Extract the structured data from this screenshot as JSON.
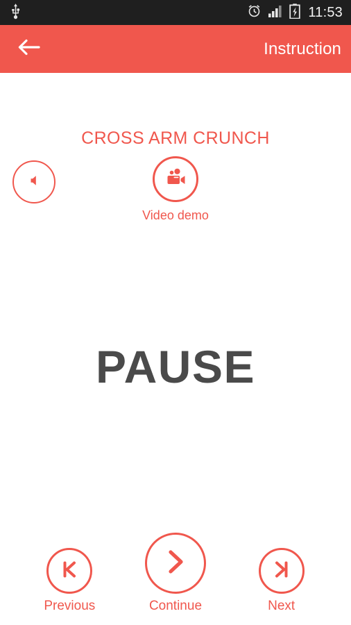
{
  "status_bar": {
    "left_icons": [
      {
        "name": "usb-icon",
        "label": "USB connected"
      }
    ],
    "right_icons": [
      {
        "name": "alarm-clock-icon",
        "label": "Alarm set"
      },
      {
        "name": "signal-bars-icon",
        "label": "Signal strength"
      },
      {
        "name": "battery-charging-icon",
        "label": "Battery charging"
      }
    ],
    "time": "11:53",
    "background_color": "#1f1f1f",
    "text_color": "#f2f2f2"
  },
  "app_bar": {
    "back_icon": "arrow-left-icon",
    "title": "Instruction",
    "background_color": "#f0574d",
    "text_color": "#ffffff"
  },
  "main": {
    "exercise_title": "CROSS ARM CRUNCH",
    "sound_button": {
      "icon": "speaker-icon",
      "label": "Sound"
    },
    "video_demo": {
      "icon": "video-camera-icon",
      "label": "Video demo"
    },
    "state_text": "PAUSE",
    "state_text_color": "#4a4a4a"
  },
  "controls": [
    {
      "name": "previous",
      "icon": "skip-previous-icon",
      "label": "Previous",
      "size": "small"
    },
    {
      "name": "continue",
      "icon": "chevron-right-icon",
      "label": "Continue",
      "size": "large"
    },
    {
      "name": "next",
      "icon": "skip-next-icon",
      "label": "Next",
      "size": "small"
    }
  ],
  "theme": {
    "accent": "#f0574d",
    "background": "#ffffff",
    "dark": "#4a4a4a"
  }
}
